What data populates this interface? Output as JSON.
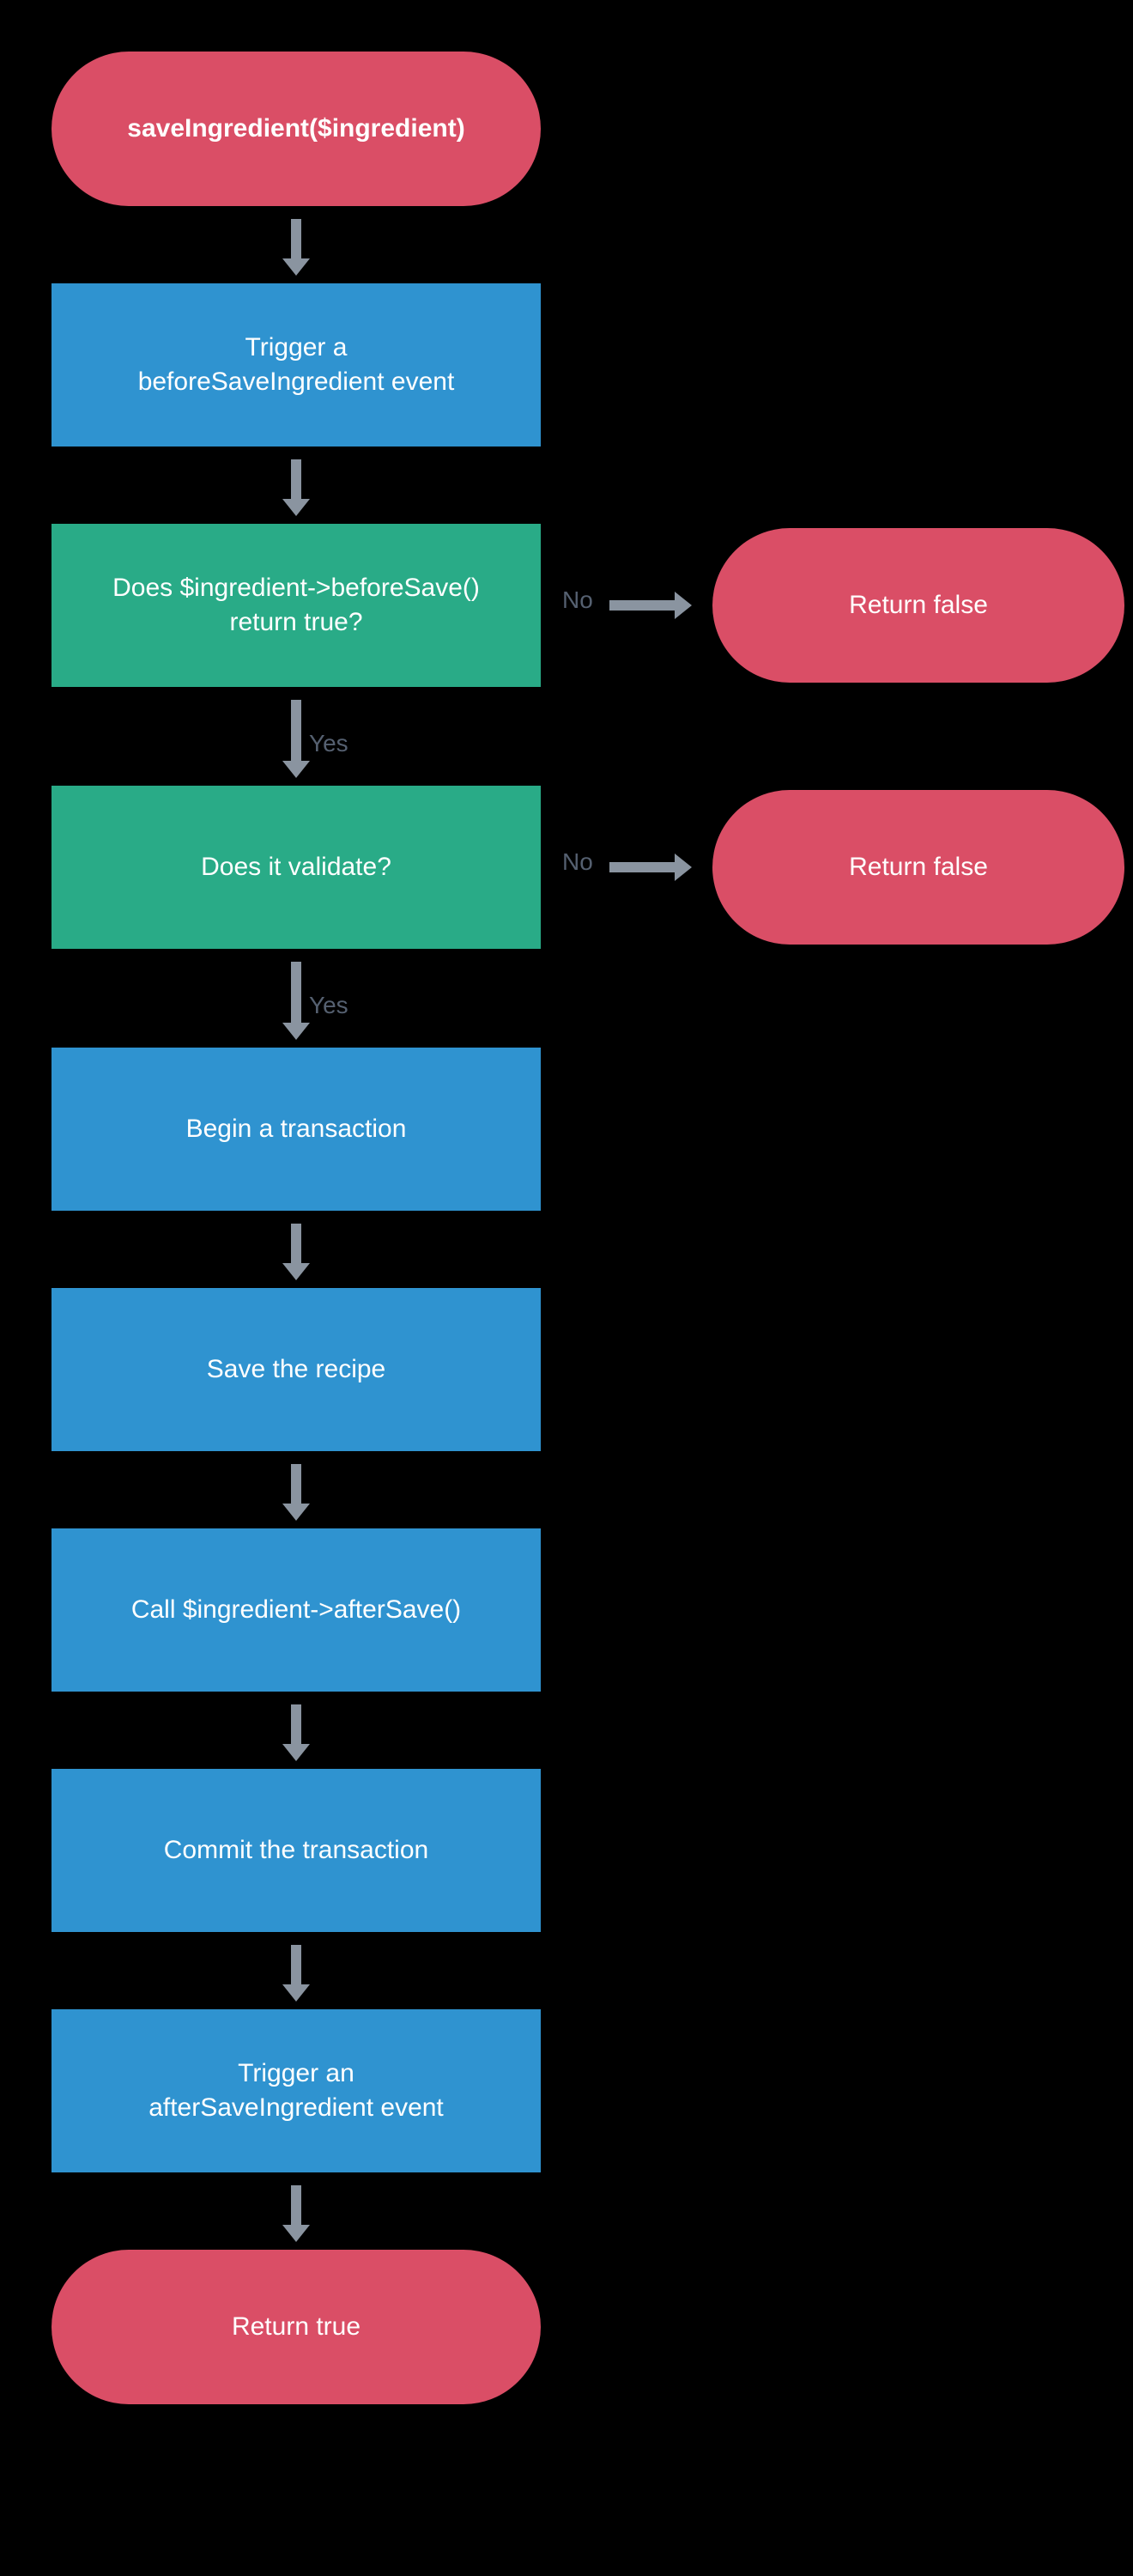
{
  "nodes": {
    "start": "saveIngredient($ingredient)",
    "triggerBefore": "Trigger a\nbeforeSaveIngredient event",
    "beforeSaveCheck": "Does $ingredient->beforeSave()\nreturn true?",
    "validateCheck": "Does it validate?",
    "returnFalse1": "Return false",
    "returnFalse2": "Return false",
    "beginTx": "Begin a transaction",
    "saveRecipe": "Save the recipe",
    "afterSaveCall": "Call $ingredient->afterSave()",
    "commitTx": "Commit the transaction",
    "triggerAfter": "Trigger an\nafterSaveIngredient event",
    "returnTrue": "Return true"
  },
  "labels": {
    "yes": "Yes",
    "no": "No"
  }
}
